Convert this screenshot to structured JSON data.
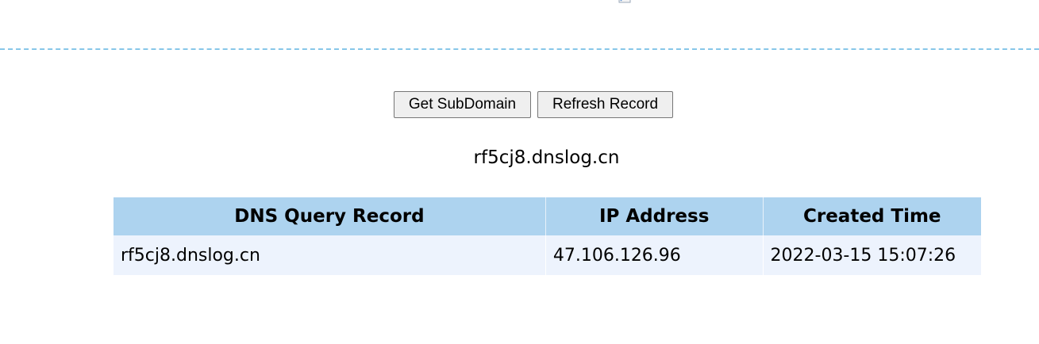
{
  "header": {
    "image_icon": "broken-image-icon"
  },
  "actions": {
    "get_subdomain_label": "Get SubDomain",
    "refresh_record_label": "Refresh Record"
  },
  "subdomain": {
    "value": "rf5cj8.dnslog.cn"
  },
  "table": {
    "headers": [
      "DNS Query Record",
      "IP Address",
      "Created Time"
    ],
    "rows": [
      [
        "rf5cj8.dnslog.cn",
        "47.106.126.96",
        "2022-03-15 15:07:26"
      ]
    ]
  },
  "colors": {
    "header_bg": "#add3ef",
    "row_bg": "#edf3fd",
    "divider": "#87c6e8"
  }
}
